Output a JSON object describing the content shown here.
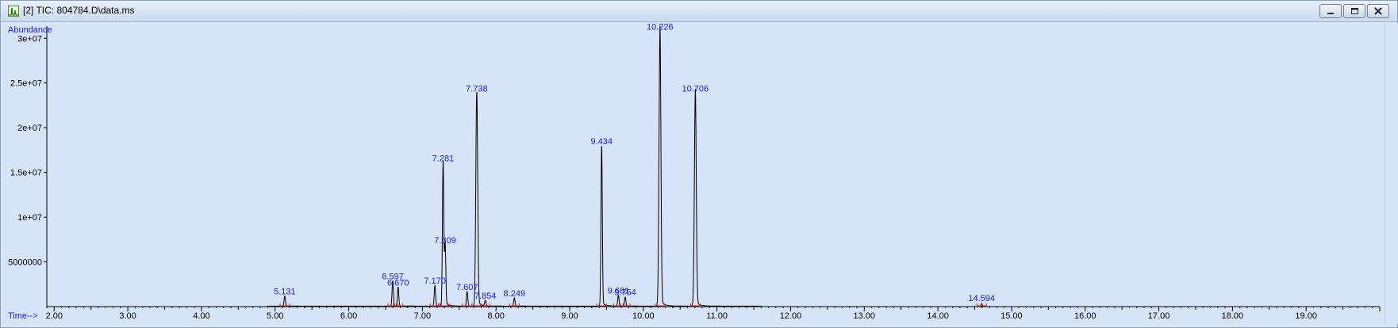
{
  "window": {
    "title": "[2] TIC: 804784.D\\data.ms",
    "icons": {
      "app": "chromatogram-app-icon",
      "minimize": "minimize-icon",
      "restore": "restore-icon",
      "close": "close-icon"
    }
  },
  "chart_data": {
    "type": "line",
    "ylabel": "Abundance",
    "xlabel": "Time-->",
    "xlim": [
      1.9,
      20.0
    ],
    "ylim": [
      0,
      31000000
    ],
    "x_ticks": [
      2.0,
      3.0,
      4.0,
      5.0,
      6.0,
      7.0,
      8.0,
      9.0,
      10.0,
      11.0,
      12.0,
      13.0,
      14.0,
      15.0,
      16.0,
      17.0,
      18.0,
      19.0
    ],
    "x_tick_labels": [
      "2.00",
      "3.00",
      "4.00",
      "5.00",
      "6.00",
      "7.00",
      "8.00",
      "9.00",
      "10.00",
      "11.00",
      "12.00",
      "13.00",
      "14.00",
      "15.00",
      "16.00",
      "17.00",
      "18.00",
      "19.00"
    ],
    "y_ticks": [
      5000000,
      10000000,
      15000000,
      20000000,
      25000000,
      30000000
    ],
    "y_tick_labels": [
      "5000000",
      "1e+07",
      "1.5e+07",
      "2e+07",
      "2.5e+07",
      "3e+07"
    ],
    "grid": false,
    "colors": {
      "trace": "#000000",
      "baseline": "#e0202a",
      "labels": "#1a1aff",
      "background": "#d6e4f7"
    },
    "peaks": [
      {
        "rt": 5.131,
        "height": 1100000,
        "label": "5.131"
      },
      {
        "rt": 6.597,
        "height": 2800000,
        "label": "6.597"
      },
      {
        "rt": 6.67,
        "height": 2100000,
        "label": "6.670"
      },
      {
        "rt": 7.17,
        "height": 2300000,
        "label": "7.170"
      },
      {
        "rt": 7.281,
        "height": 16000000,
        "label": "7.281"
      },
      {
        "rt": 7.309,
        "height": 6800000,
        "label": "7.309"
      },
      {
        "rt": 7.607,
        "height": 1600000,
        "label": "7.607"
      },
      {
        "rt": 7.738,
        "height": 23800000,
        "label": "7.738"
      },
      {
        "rt": 7.854,
        "height": 600000,
        "label": "7.854"
      },
      {
        "rt": 8.249,
        "height": 900000,
        "label": "8.249"
      },
      {
        "rt": 9.434,
        "height": 17900000,
        "label": "9.434"
      },
      {
        "rt": 9.661,
        "height": 1200000,
        "label": "9.661"
      },
      {
        "rt": 9.754,
        "height": 1000000,
        "label": "9.754"
      },
      {
        "rt": 10.226,
        "height": 30700000,
        "label": "10.226"
      },
      {
        "rt": 10.706,
        "height": 23800000,
        "label": "10.706"
      },
      {
        "rt": 14.594,
        "height": 350000,
        "label": "14.594"
      }
    ],
    "trace_end": 11.65
  }
}
